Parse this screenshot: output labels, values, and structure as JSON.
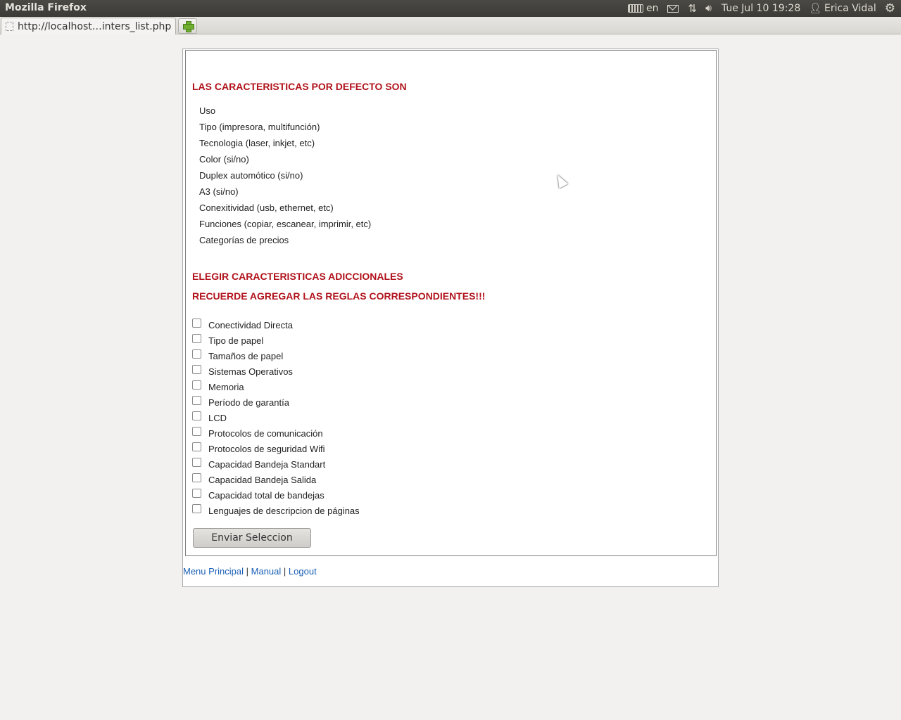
{
  "system": {
    "app_title": "Mozilla Firefox",
    "lang": "en",
    "clock": "Tue Jul 10 19:28",
    "user": "Erica Vidal"
  },
  "tab": {
    "url": "http://localhost…inters_list.php"
  },
  "page": {
    "default_heading": "LAS CARACTERISTICAS POR DEFECTO SON",
    "default_items": [
      "Uso",
      "Tipo (impresora, multifunción)",
      "Tecnologia (laser, inkjet, etc)",
      "Color (si/no)",
      "Duplex automótico (si/no)",
      "A3 (si/no)",
      "Conexitividad (usb, ethernet, etc)",
      "Funciones (copiar, escanear, imprimir, etc)",
      "Categorías de precios"
    ],
    "additional_heading": "ELEGIR CARACTERISTICAS ADICCIONALES",
    "reminder": "RECUERDE AGREGAR LAS REGLAS CORRESPONDIENTES!!!",
    "options": [
      "Conectividad Directa",
      "Tipo de papel",
      "Tamaños de papel",
      "Sistemas Operativos",
      "Memoria",
      "Período de garantía",
      "LCD",
      "Protocolos de comunicación",
      "Protocolos de seguridad Wifi",
      "Capacidad Bandeja Standart",
      "Capacidad Bandeja Salida",
      "Capacidad total de bandejas",
      "Lenguajes de descripcion de páginas"
    ],
    "submit_label": "Enviar Seleccion",
    "footer": {
      "menu": "Menu Principal",
      "manual": "Manual",
      "logout": "Logout",
      "sep": "|"
    }
  }
}
